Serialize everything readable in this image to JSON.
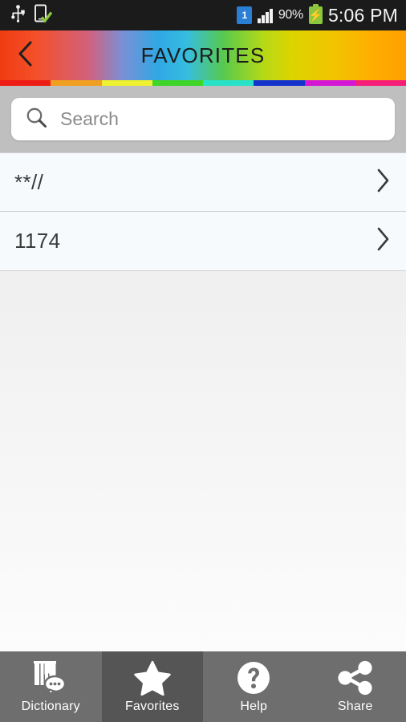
{
  "status_bar": {
    "usb_icon": "usb-icon",
    "device_sync_icon": "device-checked-icon",
    "sim_badge": "1",
    "signal_icon": "signal-bars-icon",
    "battery_percent": "90%",
    "battery_icon": "battery-charging-icon",
    "time": "5:06 PM"
  },
  "header": {
    "back_icon": "chevron-left-icon",
    "title": "FAVORITES",
    "stripe_colors": [
      "#ee1c16",
      "#f0a020",
      "#eef130",
      "#3fd428",
      "#27e2c6",
      "#1433cc",
      "#d417d4",
      "#f51f7a"
    ]
  },
  "search": {
    "icon": "search-icon",
    "placeholder": "Search",
    "value": ""
  },
  "list": {
    "rows": [
      {
        "label": "**//",
        "chevron": "chevron-right-icon"
      },
      {
        "label": "1174",
        "chevron": "chevron-right-icon"
      }
    ]
  },
  "tabbar": {
    "tabs": [
      {
        "label": "Dictionary",
        "icon": "dictionary-icon",
        "active": false
      },
      {
        "label": "Favorites",
        "icon": "star-icon",
        "active": true
      },
      {
        "label": "Help",
        "icon": "question-circle-icon",
        "active": false
      },
      {
        "label": "Share",
        "icon": "share-icon",
        "active": false
      }
    ]
  },
  "colors": {
    "statusbar_bg": "#1b1b1b",
    "search_bg": "#bfbfbf",
    "row_bg": "#f7fafd",
    "tabbar_bg": "#6e6e6e",
    "tab_active_bg": "#555555",
    "battery_green": "#8cc63e",
    "sim_blue": "#2a7fd4"
  }
}
